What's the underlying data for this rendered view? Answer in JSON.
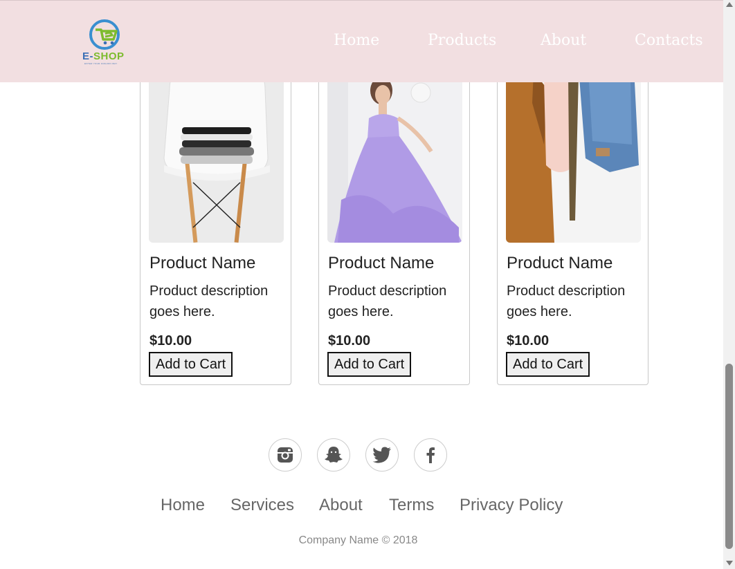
{
  "header": {
    "logo_text_e": "E-",
    "logo_text_shop": "SHOP",
    "logo_tagline": "ENTER YOUR FASHION WAY",
    "nav": [
      "Home",
      "Products",
      "About",
      "Contacts"
    ]
  },
  "products": [
    {
      "name": "Product Name",
      "description": "Product description goes here.",
      "price": "$10.00",
      "button": "Add to Cart",
      "image": "white chair with folded clothes"
    },
    {
      "name": "Product Name",
      "description": "Product description goes here.",
      "price": "$10.00",
      "button": "Add to Cart",
      "image": "woman in lavender gown"
    },
    {
      "name": "Product Name",
      "description": "Product description goes here.",
      "price": "$10.00",
      "button": "Add to Cart",
      "image": "clothes on rack: jacket, blouse, denim"
    }
  ],
  "footer": {
    "social": [
      "instagram-icon",
      "snapchat-icon",
      "twitter-icon",
      "facebook-icon"
    ],
    "links": [
      "Home",
      "Services",
      "About",
      "Terms",
      "Privacy Policy"
    ],
    "copyright": "Company Name © 2018"
  },
  "colors": {
    "header_bg": "#f2dfe1",
    "nav_text": "#ffffff",
    "logo_blue": "#3a6fb5",
    "logo_green": "#7dbb2e",
    "footer_link": "#666666"
  }
}
